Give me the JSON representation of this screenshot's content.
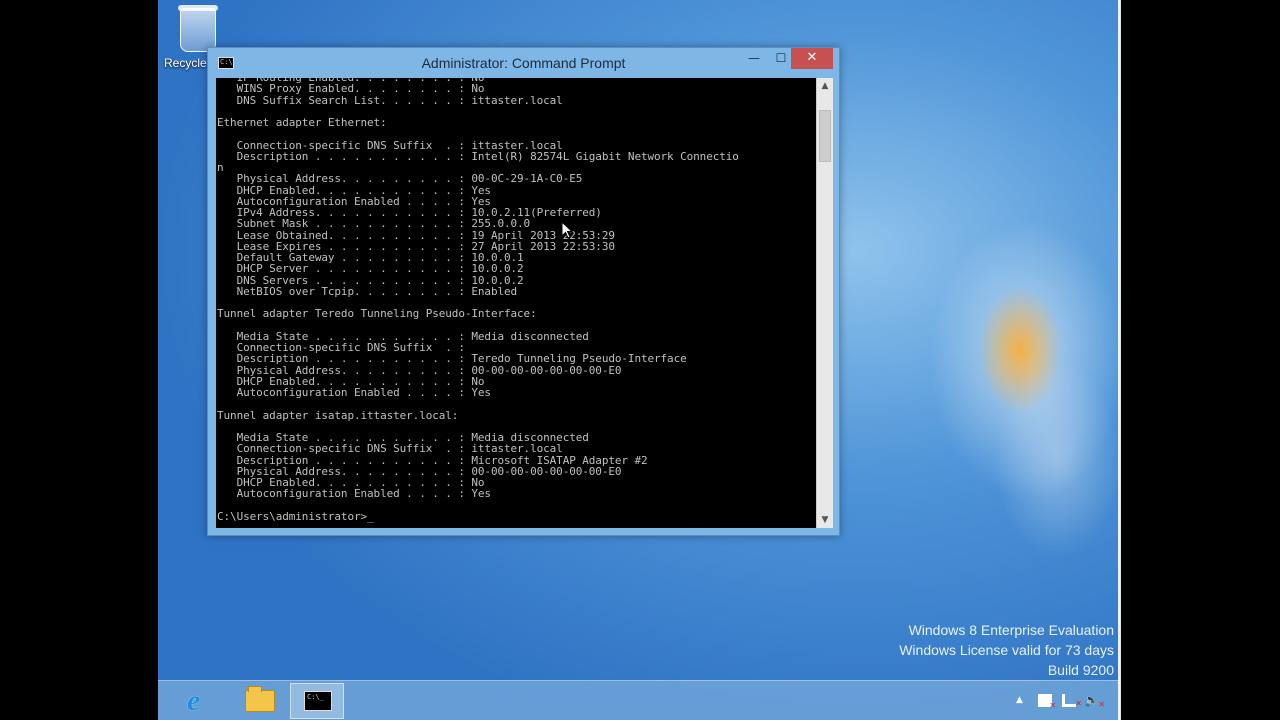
{
  "desktop": {
    "icons": [
      {
        "label": "Recycle",
        "icon": "recycle-bin-icon"
      }
    ],
    "watermark": {
      "line1": "Windows 8 Enterprise Evaluation",
      "line2": "Windows License valid for 73 days",
      "line3": "Build 9200"
    }
  },
  "window": {
    "title": "Administrator: Command Prompt",
    "icon": "cmd-icon",
    "buttons": {
      "minimize": "—",
      "maximize": "☐",
      "close": "✕"
    },
    "console_text": "   IP Routing Enabled. . . . . . . . : No\n   WINS Proxy Enabled. . . . . . . . : No\n   DNS Suffix Search List. . . . . . : ittaster.local\n\nEthernet adapter Ethernet:\n\n   Connection-specific DNS Suffix  . : ittaster.local\n   Description . . . . . . . . . . . : Intel(R) 82574L Gigabit Network Connectio\nn\n   Physical Address. . . . . . . . . : 00-0C-29-1A-C0-E5\n   DHCP Enabled. . . . . . . . . . . : Yes\n   Autoconfiguration Enabled . . . . : Yes\n   IPv4 Address. . . . . . . . . . . : 10.0.2.11(Preferred)\n   Subnet Mask . . . . . . . . . . . : 255.0.0.0\n   Lease Obtained. . . . . . . . . . : 19 April 2013 22:53:29\n   Lease Expires . . . . . . . . . . : 27 April 2013 22:53:30\n   Default Gateway . . . . . . . . . : 10.0.0.1\n   DHCP Server . . . . . . . . . . . : 10.0.0.2\n   DNS Servers . . . . . . . . . . . : 10.0.0.2\n   NetBIOS over Tcpip. . . . . . . . : Enabled\n\nTunnel adapter Teredo Tunneling Pseudo-Interface:\n\n   Media State . . . . . . . . . . . : Media disconnected\n   Connection-specific DNS Suffix  . :\n   Description . . . . . . . . . . . : Teredo Tunneling Pseudo-Interface\n   Physical Address. . . . . . . . . : 00-00-00-00-00-00-00-E0\n   DHCP Enabled. . . . . . . . . . . : No\n   Autoconfiguration Enabled . . . . : Yes\n\nTunnel adapter isatap.ittaster.local:\n\n   Media State . . . . . . . . . . . : Media disconnected\n   Connection-specific DNS Suffix  . : ittaster.local\n   Description . . . . . . . . . . . : Microsoft ISATAP Adapter #2\n   Physical Address. . . . . . . . . : 00-00-00-00-00-00-00-E0\n   DHCP Enabled. . . . . . . . . . . : No\n   Autoconfiguration Enabled . . . . : Yes\n\nC:\\Users\\administrator>_",
    "scrollbar": {
      "up": "▲",
      "down": "▼"
    }
  },
  "taskbar": {
    "items": [
      {
        "name": "Internet Explorer",
        "icon": "ie-icon",
        "glyph": "e"
      },
      {
        "name": "File Explorer",
        "icon": "folder-icon"
      },
      {
        "name": "Command Prompt",
        "icon": "cmd-icon",
        "active": true
      }
    ],
    "tray": {
      "chevron": "▲",
      "icons": [
        "action-center-flag-icon",
        "network-icon",
        "volume-icon"
      ]
    }
  },
  "colors": {
    "console_bg": "#000000",
    "console_fg": "#c0c0c0",
    "close_button": "#c75050",
    "window_frame": "#7eb6e6"
  }
}
